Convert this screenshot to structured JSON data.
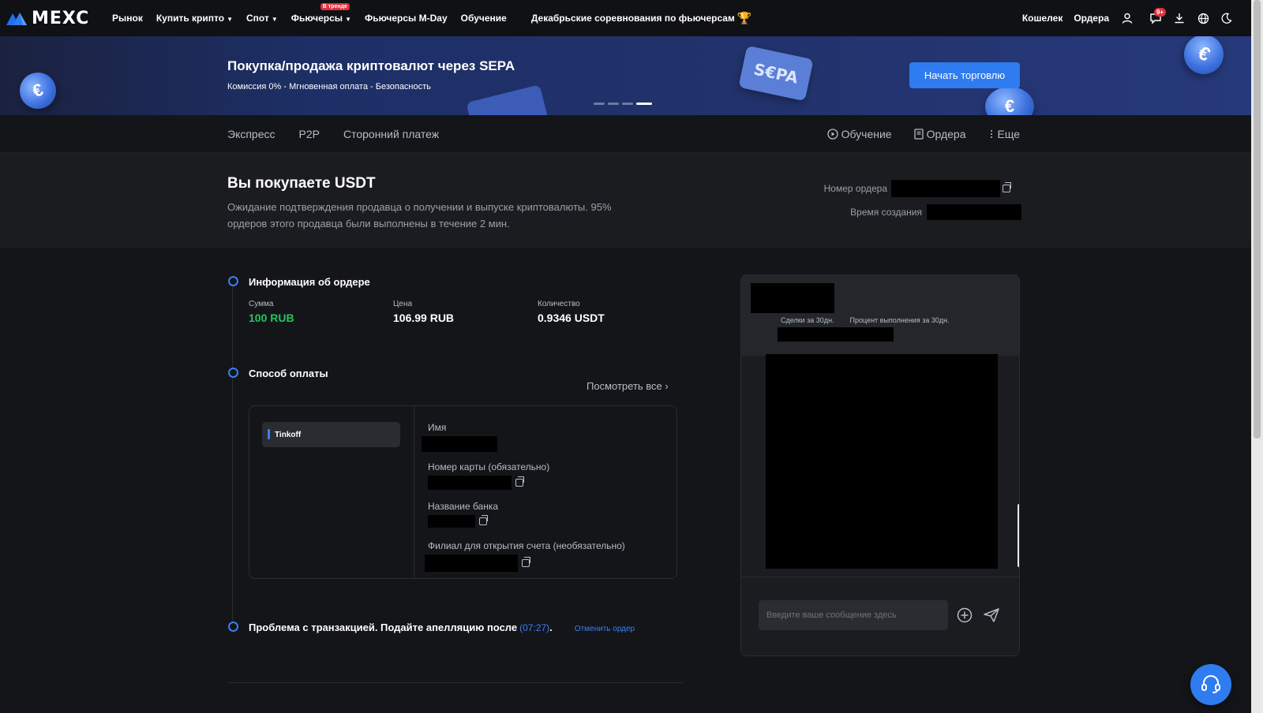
{
  "brand": {
    "name": "MEXC",
    "accent": "#2f7bf0",
    "green": "#23c45e"
  },
  "nav": {
    "items": [
      {
        "label": "Рынок",
        "caret": false
      },
      {
        "label": "Купить крипто",
        "caret": true
      },
      {
        "label": "Спот",
        "caret": true
      },
      {
        "label": "Фьючерсы",
        "caret": true,
        "badge": "В тренде"
      },
      {
        "label": "Фьючерсы M-Day",
        "caret": false
      },
      {
        "label": "Обучение",
        "caret": false
      }
    ],
    "promo": "Декабрьские соревнования по фьючерсам",
    "right": {
      "wallet": "Кошелек",
      "orders": "Ордера",
      "notif_badge": "9+"
    },
    "icons": [
      "user-icon",
      "chat-notification-icon",
      "download-icon",
      "globe-icon",
      "moon-icon"
    ]
  },
  "banner": {
    "title": "Покупка/продажа криптовалют через SEPA",
    "subtitle": "Комиссия 0% - Мгновенная оплата - Безопасность",
    "button": "Начать торговлю",
    "card_text": "S€PA",
    "coin_symbol": "€",
    "slides": 4,
    "active_slide": 4
  },
  "subnav": {
    "left": [
      "Экспресс",
      "P2P",
      "Сторонний платеж"
    ],
    "right": {
      "tutorial": "Обучение",
      "orders": "Ордера",
      "more": "Еще"
    }
  },
  "order": {
    "title": "Вы покупаете USDT",
    "description": "Ожидание подтверждения продавца о получении и выпуске криптовалюты. 95% ордеров этого продавца были выполнены в течение 2 мин.",
    "order_no_label": "Номер ордера",
    "created_label": "Время создания"
  },
  "steps": {
    "info": {
      "title": "Информация об ордере",
      "amount_label": "Сумма",
      "amount": "100 RUB",
      "price_label": "Цена",
      "price": "106.99 RUB",
      "qty_label": "Количество",
      "qty": "0.9346 USDT"
    },
    "payment": {
      "title": "Способ оплаты",
      "view_all": "Посмотреть все ›",
      "method": "Tinkoff",
      "fields": {
        "name": "Имя",
        "card": "Номер карты (обязательно)",
        "bank": "Название банка",
        "branch": "Филиал для открытия счета (необязательно)"
      }
    },
    "problem": {
      "text": "Проблема с транзакцией. Подайте апелляцию после",
      "timer": "(07:27)",
      "period": ".",
      "cancel": "Отменить ордер"
    }
  },
  "chat": {
    "stat_trades": "Сделки за 30дн.",
    "stat_completion": "Процент выполнения за 30дн.",
    "placeholder": "Введите ваше сообщение здесь"
  }
}
